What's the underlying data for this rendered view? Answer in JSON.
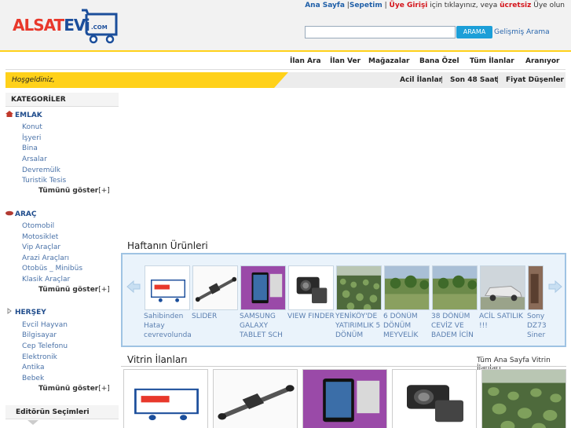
{
  "header": {
    "logo_text_a": "ALSAT",
    "logo_text_b": "EVi",
    "logo_com": ".COM",
    "links": {
      "home": "Ana Sayfa",
      "sep1": "|",
      "cart": "Sepetim",
      "sep2": "|",
      "login": "Üye Girişi",
      "mid": "için tıklayınız, veya",
      "free": "ücretsiz",
      "join": "Üye olun"
    },
    "search": {
      "placeholder": "",
      "button": "ARAMA",
      "advanced": "Gelişmiş Arama"
    }
  },
  "nav": {
    "items": [
      "İlan Ara",
      "İlan Ver",
      "Mağazalar",
      "Bana Özel",
      "Tüm İlanlar",
      "Aranıyor"
    ]
  },
  "welcome": {
    "text": "Hoşgeldiniz,",
    "links": [
      "Acil İlanlar",
      "Son 48 Saat",
      "Fiyat Düşenler"
    ],
    "separator": "|"
  },
  "sidebar": {
    "title": "KATEGORİLER",
    "categories": [
      {
        "name": "EMLAK",
        "items": [
          "Konut",
          "İşyeri",
          "Bina",
          "Arsalar",
          "Devremülk",
          "Turistik Tesis"
        ],
        "more": "Tümünü göster",
        "more_suffix": "[+]"
      },
      {
        "name": "ARAÇ",
        "items": [
          "Otomobil",
          "Motosiklet",
          "Vip Araçlar",
          "Arazi Araçları",
          "Otobüs _ Minibüs",
          "Klasik Araçlar"
        ],
        "more": "Tümünü göster",
        "more_suffix": "[+]"
      },
      {
        "name": "HERŞEY",
        "items": [
          "Evcil Hayvan",
          "Bilgisayar",
          "Cep Telefonu",
          "Elektronik",
          "Antika",
          "Bebek"
        ],
        "more": "Tümünü göster",
        "more_suffix": "[+]"
      }
    ],
    "editor_title": "Editörün Seçimleri"
  },
  "week": {
    "title": "Haftanın Ürünleri",
    "products": [
      {
        "caption": "Sahibinden Hatay çevreyolunda",
        "thumb": "logo"
      },
      {
        "caption": "SLIDER",
        "thumb": "slider"
      },
      {
        "caption": "SAMSUNG GALAXY TABLET SCH",
        "thumb": "tablet"
      },
      {
        "caption": "VIEW FINDER",
        "thumb": "camera"
      },
      {
        "caption": "YENİKÖY'DE YATIRIMLIK 5 DÖNÜM",
        "thumb": "field"
      },
      {
        "caption": "6 DÖNÜM DÖNÜM MEYVELİK",
        "thumb": "orchard"
      },
      {
        "caption": "38 DÖNÜM CEVİZ VE BADEM İÇİN",
        "thumb": "orchard"
      },
      {
        "caption": "ACİL SATILIK !!!",
        "thumb": "car"
      },
      {
        "caption": "Sony DZ73 Siner",
        "thumb": "sony"
      }
    ]
  },
  "vitrin": {
    "title": "Vitrin İlanları",
    "all_link": "Tüm Ana Sayfa Vitrin İlanları",
    "cards": [
      "logo",
      "slider",
      "tablet",
      "camera",
      "field"
    ]
  },
  "colors": {
    "brand_red": "#e8382b",
    "brand_blue": "#1b4e9b",
    "accent_yellow": "#ffd11a",
    "link_blue": "#4a72a8",
    "search_button": "#1c9fd8"
  }
}
